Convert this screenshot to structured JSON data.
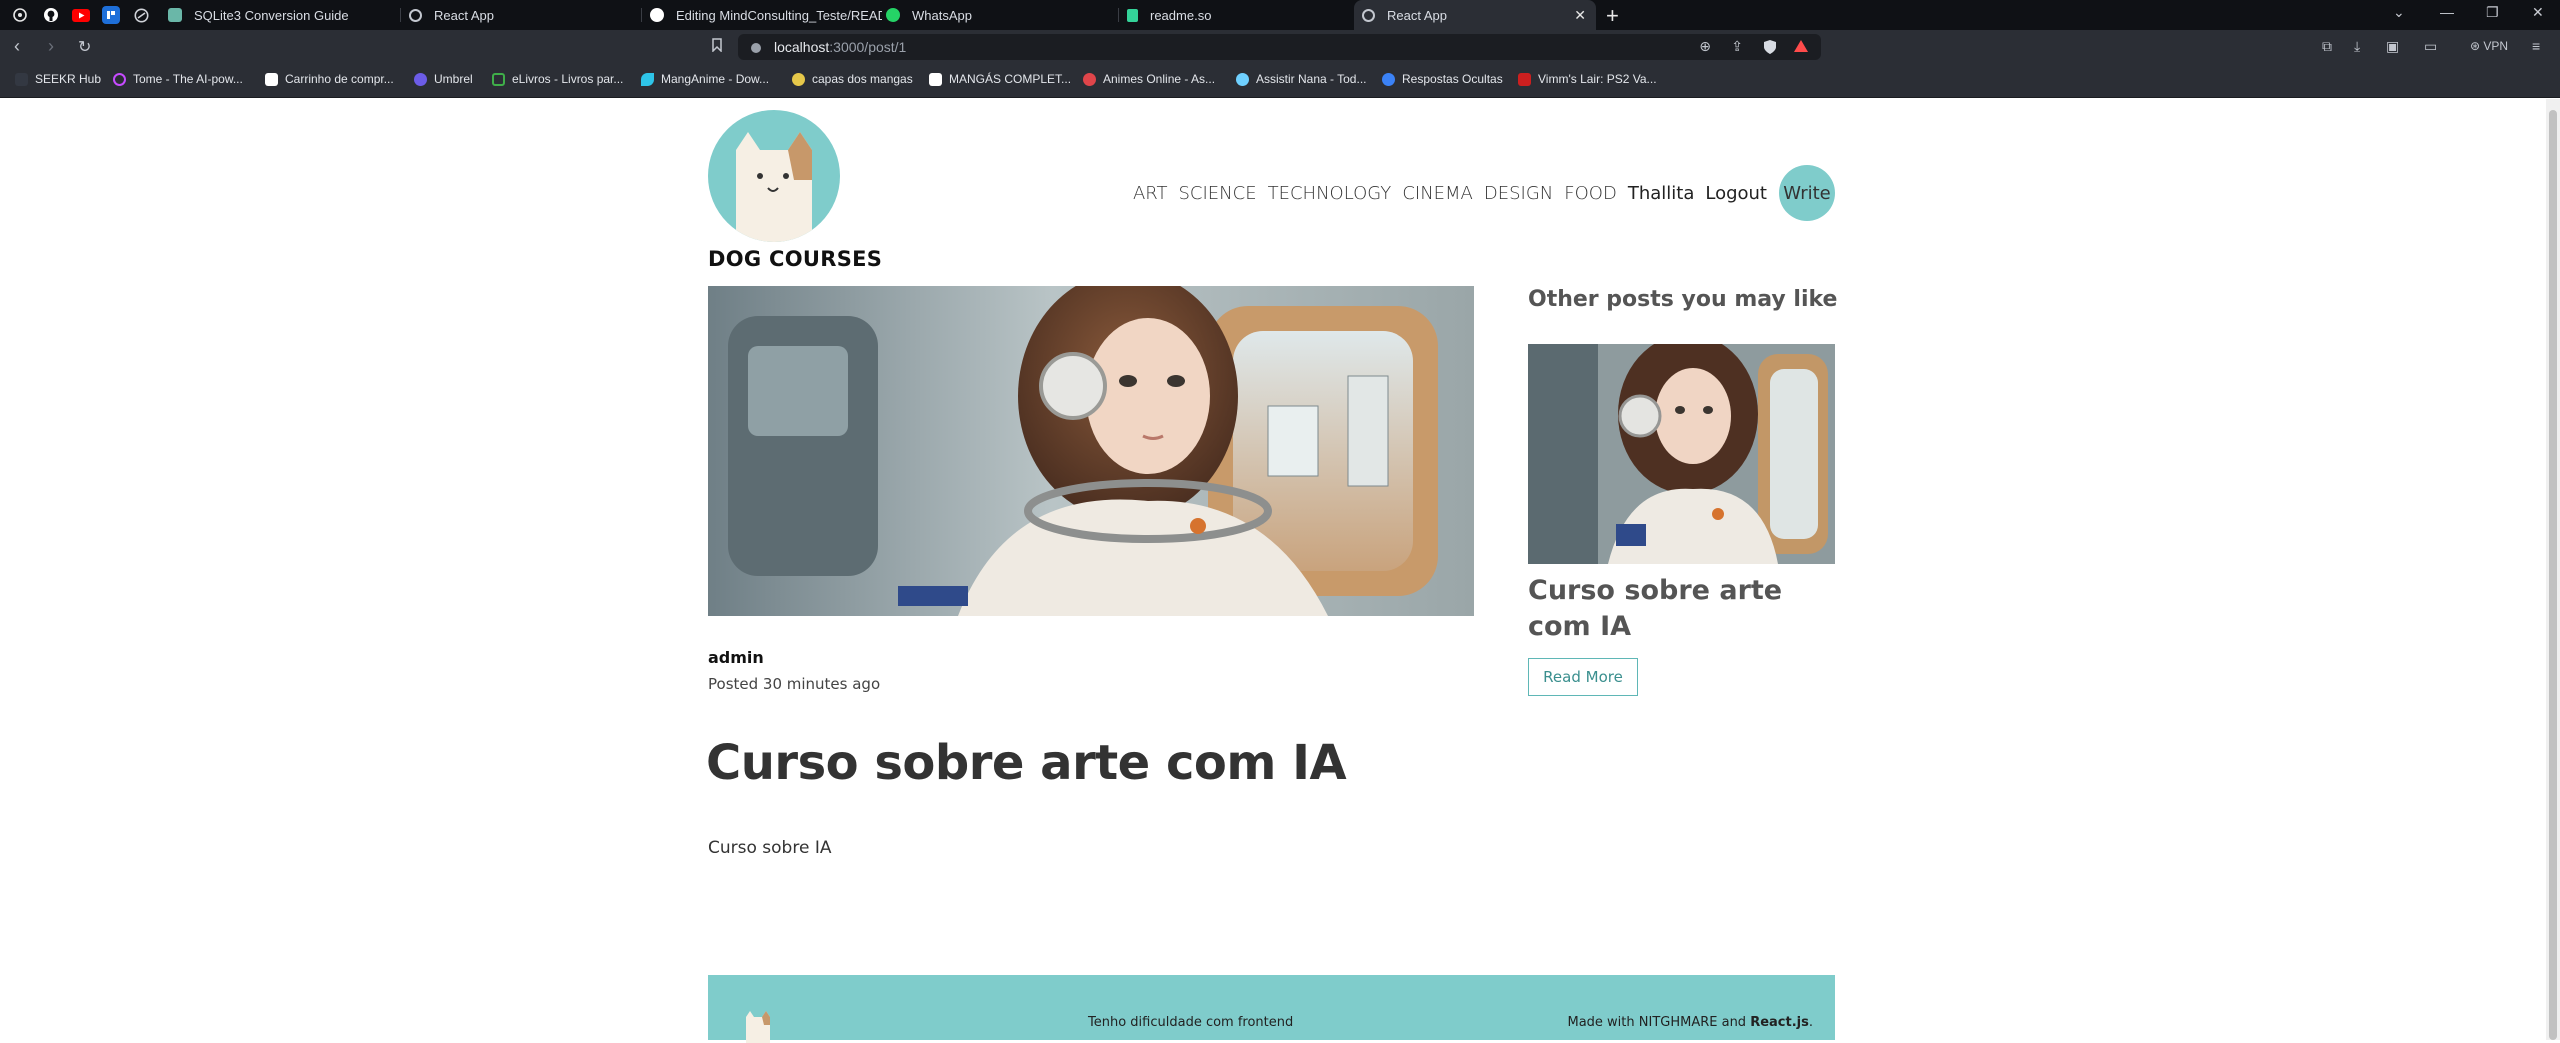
{
  "browser": {
    "tabs": [
      {
        "label": "SQLite3 Conversion Guide",
        "color": "#6ab7a8"
      },
      {
        "label": "React App",
        "color": "#c3c7cf"
      },
      {
        "label": "Editing MindConsulting_Teste/README",
        "color": "#ffffff"
      },
      {
        "label": "WhatsApp",
        "color": "#25d366"
      },
      {
        "label": "readme.so",
        "color": "#34d399"
      },
      {
        "label": "React App",
        "color": "#c3c7cf"
      }
    ],
    "url_host": "localhost",
    "url_path": ":3000/post/1",
    "vpn_label": "VPN",
    "bookmarks": [
      {
        "label": "SEEKR Hub",
        "color": "#333842"
      },
      {
        "label": "Tome - The AI-pow...",
        "color": "#c64bff"
      },
      {
        "label": "Carrinho de compr...",
        "color": "#ffffff"
      },
      {
        "label": "Umbrel",
        "color": "#6c5ce7"
      },
      {
        "label": "eLivros - Livros par...",
        "color": "#3fae49"
      },
      {
        "label": "MangAnime - Dow...",
        "color": "#2ec4e8"
      },
      {
        "label": "capas dos mangas",
        "color": "#e6c84a"
      },
      {
        "label": "MANGÁS COMPLET...",
        "color": "#ffffff"
      },
      {
        "label": "Animes Online - As...",
        "color": "#e0454a"
      },
      {
        "label": "Assistir Nana - Tod...",
        "color": "#6fd0ff"
      },
      {
        "label": "Respostas Ocultas",
        "color": "#3b82f6"
      },
      {
        "label": "Vimm's Lair: PS2 Va...",
        "color": "#cc1f1f"
      }
    ]
  },
  "site": {
    "brand": "DOG COURSES",
    "nav": [
      "ART",
      "SCIENCE",
      "TECHNOLOGY",
      "CINEMA",
      "DESIGN",
      "FOOD"
    ],
    "user": "Thallita",
    "logout": "Logout",
    "write": "Write",
    "accent": "#7fcccb"
  },
  "post": {
    "author": "admin",
    "posted": "Posted 30 minutes ago",
    "title": "Curso sobre arte com IA",
    "body": "Curso sobre IA"
  },
  "sidebar": {
    "heading": "Other posts you may like",
    "title": "Curso sobre arte com IA",
    "read_more": "Read More"
  },
  "footer": {
    "text": "Tenho dificuldade com frontend",
    "made_with": "Made with NITGHMARE and",
    "react": "React.js",
    "dot": "."
  }
}
